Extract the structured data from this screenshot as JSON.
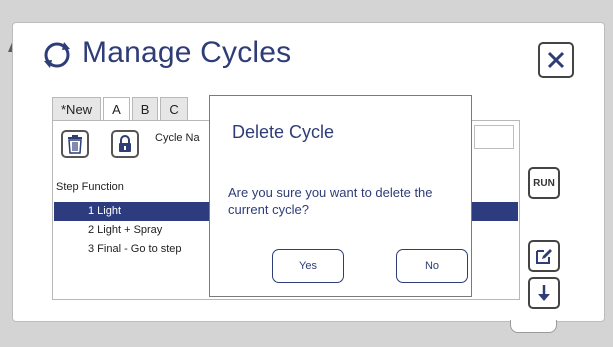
{
  "window": {
    "title": "Manage Cycles"
  },
  "tabs": [
    {
      "label": "*New"
    },
    {
      "label": "A"
    },
    {
      "label": "B"
    },
    {
      "label": "C"
    }
  ],
  "form": {
    "cycle_name_label": "Cycle Na"
  },
  "steps": {
    "header": "Step Function",
    "rows": [
      {
        "label": "1 Light"
      },
      {
        "label": "2 Light + Spray"
      },
      {
        "label": "3 Final - Go to step"
      }
    ]
  },
  "side_buttons": {
    "run_label": "RUN"
  },
  "dialog": {
    "title": "Delete Cycle",
    "message": "Are you sure you want to delete the current cycle?",
    "yes_label": "Yes",
    "no_label": "No"
  },
  "colors": {
    "accent": "#2e3d77",
    "selection": "#2d3c7f"
  }
}
